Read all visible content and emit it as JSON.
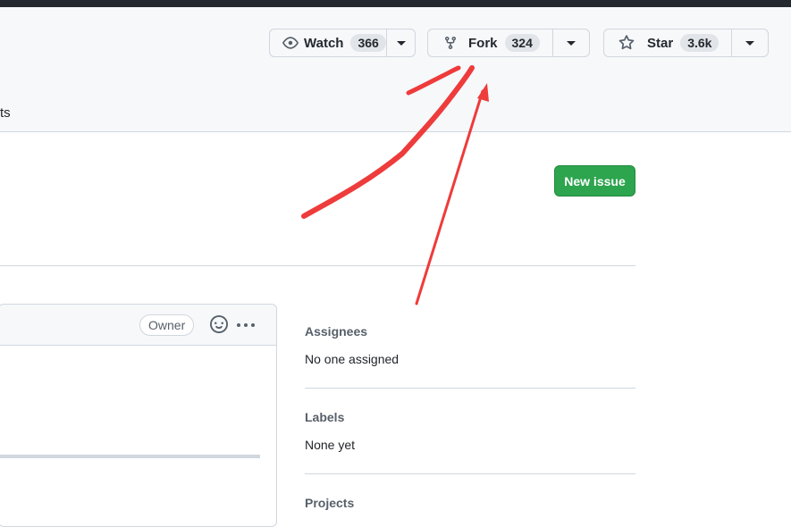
{
  "header": {
    "watch": {
      "label": "Watch",
      "count": "366"
    },
    "fork": {
      "label": "Fork",
      "count": "324"
    },
    "star": {
      "label": "Star",
      "count": "3.6k"
    },
    "tab_fragment": "ts"
  },
  "actions": {
    "new_issue": "New issue"
  },
  "comment": {
    "owner_badge": "Owner"
  },
  "sidebar": {
    "assignees": {
      "heading": "Assignees",
      "value": "No one assigned"
    },
    "labels": {
      "heading": "Labels",
      "value": "None yet"
    },
    "projects": {
      "heading": "Projects"
    }
  },
  "colors": {
    "annotation": "#ee3b3b",
    "primary_button": "#2da44e"
  }
}
